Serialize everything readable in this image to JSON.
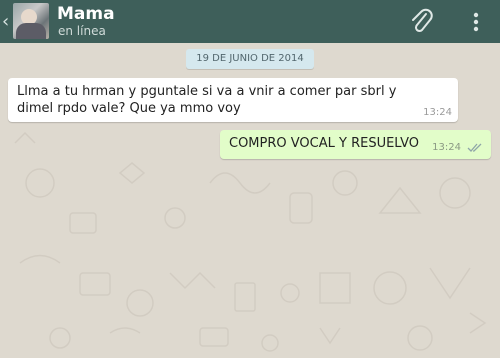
{
  "header": {
    "contact_name": "Mama",
    "status": "en línea"
  },
  "conversation": {
    "date_label": "19 DE JUNIO DE 2014",
    "messages": [
      {
        "direction": "incoming",
        "text": "Llma a tu hrman y pguntale si va a vnir a comer par sbrl y dimel rpdo vale? Que ya mmo voy",
        "time": "13:24"
      },
      {
        "direction": "outgoing",
        "text": "COMPRO VOCAL Y RESUELVO",
        "time": "13:24",
        "status_icon": "double-check-icon"
      }
    ]
  },
  "icons": {
    "back": "back-chevron-icon",
    "attach": "paperclip-icon",
    "menu": "overflow-menu-icon"
  },
  "colors": {
    "header": "#3e5f5a",
    "chat_background": "#ded9cf",
    "incoming_bubble": "#ffffff",
    "outgoing_bubble": "#e2fdc9",
    "date_pill": "#d5e8ee"
  }
}
